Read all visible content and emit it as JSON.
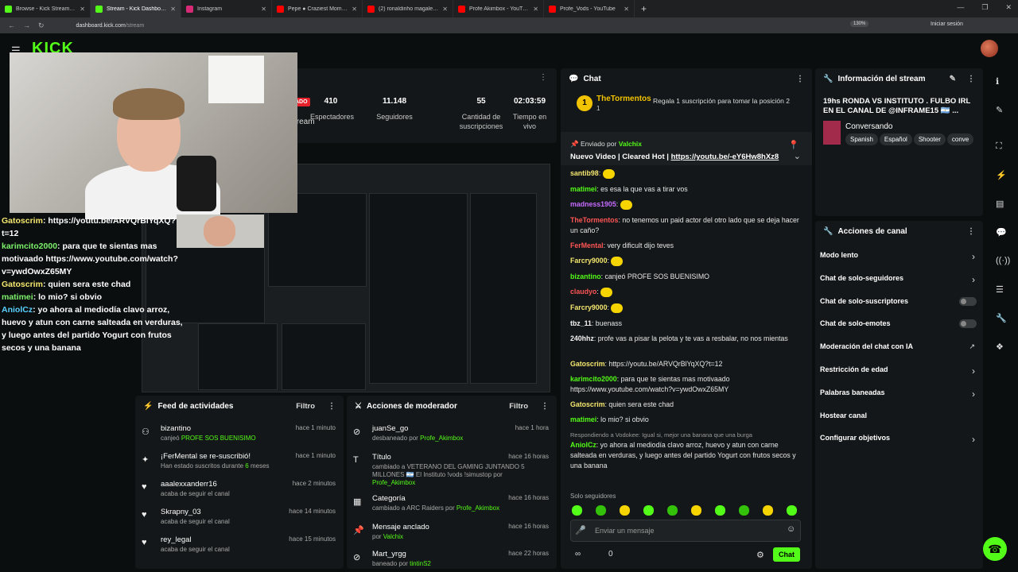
{
  "browser": {
    "tabs": [
      {
        "title": "Browse - Kick Streaming",
        "color": "#53fc18",
        "active": false
      },
      {
        "title": "Stream - Kick Dashboard",
        "color": "#53fc18",
        "active": true
      },
      {
        "title": "Instagram",
        "color": "#d62976",
        "active": false
      },
      {
        "title": "Pepe ● Craziest Moments ●",
        "color": "#ff0000",
        "active": false
      },
      {
        "title": "(2) ronaldinho magalenha - Yo",
        "color": "#ff0000",
        "active": false
      },
      {
        "title": "Profe Akimbox - YouTube",
        "color": "#ff0000",
        "active": false
      },
      {
        "title": "Profe_Vods - YouTube",
        "color": "#ff0000",
        "active": false
      }
    ],
    "url_host": "dashboard.kick.com",
    "url_path": "/stream",
    "zoom": "130%",
    "signin": "Iniciar sesión"
  },
  "header": {
    "logo": "KICK"
  },
  "stats": {
    "live_label": "ADO",
    "stream_label": "tream",
    "items": [
      {
        "value": "410",
        "label": "Espectadores"
      },
      {
        "value": "11.148",
        "label": "Seguidores"
      },
      {
        "value": "55",
        "label": "Cantidad de suscripciones"
      },
      {
        "value": "02:03:59",
        "label": "Tiempo en vivo"
      }
    ]
  },
  "overlay_chat": [
    {
      "user": "Gatoscrim",
      "text": ": https://youtu.be/ARVQrBlYqXQ?t=12"
    },
    {
      "user": "karimcito2000",
      "text": ": para que te sientas mas motivaado https://www.youtube.com/watch?v=ywdOwxZ65MY"
    },
    {
      "user": "Gatoscrim",
      "text": ": quien sera este chad"
    },
    {
      "user": "matimei",
      "text": ": lo mio? si obvio"
    },
    {
      "user": "AniolCz",
      "text": ": yo ahora al mediodía clavo arroz, huevo y atun con carne salteada en verduras, y luego antes del partido Yogurt con frutos secos y una banana"
    }
  ],
  "feed": {
    "title": "Feed de actividades",
    "filter": "Filtro",
    "items": [
      {
        "name": "bizantino",
        "desc": "canjeó",
        "extra": "PROFE SOS BUENISIMO",
        "time": "hace 1 minuto",
        "icon": "redeem-icon"
      },
      {
        "name": "¡FerMental se re-suscribió!",
        "desc": "Han estado suscritos durante",
        "extra": "6",
        "desc2": "meses",
        "time": "hace 1 minuto",
        "icon": "sparkle-icon"
      },
      {
        "name": "aaalexxanderr16",
        "desc": "acaba de seguir el canal",
        "time": "hace 2 minutos",
        "icon": "heart-icon"
      },
      {
        "name": "Skrapny_03",
        "desc": "acaba de seguir el canal",
        "time": "hace 14 minutos",
        "icon": "heart-icon"
      },
      {
        "name": "rey_legal",
        "desc": "acaba de seguir el canal",
        "time": "hace 15 minutos",
        "icon": "heart-icon"
      }
    ]
  },
  "mod": {
    "title": "Acciones de moderador",
    "filter": "Filtro",
    "items": [
      {
        "name": "juanSe_go",
        "desc": "desbaneado por",
        "by": "Profe_Akimbox",
        "time": "hace 1 hora"
      },
      {
        "name": "Título",
        "desc": "cambiado a VETERANO DEL GAMING JUNTANDO 5 MILLONES 🇦🇷 El Instituto !vods !simustop por",
        "by": "Profe_Akimbox",
        "time": "hace 16 horas"
      },
      {
        "name": "Categoría",
        "desc": "cambiado a ARC Raiders por",
        "by": "Profe_Akimbox",
        "time": "hace 16 horas"
      },
      {
        "name": "Mensaje anclado",
        "desc": "por",
        "by": "Valchix",
        "time": "hace 16 horas"
      },
      {
        "name": "Mart_yrgg",
        "desc": "baneado por",
        "by": "tintinS2",
        "time": "hace 22 horas"
      }
    ]
  },
  "chat": {
    "title": "Chat",
    "top_gifter": {
      "rank": "1",
      "name": "TheTormentos",
      "count": "1"
    },
    "gift_prompt": "Regala 1 suscripción para tomar la posición 2",
    "pinned": {
      "by_label": "Enviado por",
      "by": "Valchix",
      "text": "Nuevo Video | Cleared Hot |",
      "link": "https://youtu.be/-eY6Hw8hXz8"
    },
    "messages": [
      {
        "user": "santib98",
        "text": "",
        "color": "#f4e76e"
      },
      {
        "user": "matimei",
        "text": "es esa la que vas a tirar vos",
        "color": "#53fc18"
      },
      {
        "user": "madness1905",
        "text": "",
        "color": "#c56bff"
      },
      {
        "user": "TheTormentos",
        "text": "no tenemos un paid actor del otro lado que se deja hacer un caño?",
        "color": "#ff5555"
      },
      {
        "user": "FerMental",
        "text": "very dificult dijo teves",
        "color": "#ff5555"
      },
      {
        "user": "Farcry9000",
        "text": "",
        "color": "#f4e76e"
      },
      {
        "user": "bizantino",
        "text": "canjeó PROFE SOS BUENISIMO",
        "color": "#53fc18"
      },
      {
        "user": "claudyo",
        "text": "",
        "color": "#ff5555"
      },
      {
        "user": "Farcry9000",
        "text": "",
        "color": "#f4e76e"
      },
      {
        "user": "tbz_11",
        "text": "buenass",
        "color": "#f4f4f4"
      },
      {
        "user": "240hhz",
        "text": "profe vas a pisar la pelota y te vas a resbalar, no nos mientas",
        "color": "#f4f4f4"
      },
      {
        "user": "Gatoscrim",
        "text": "https://youtu.be/ARVQrBlYqXQ?t=12",
        "color": "#f4e76e"
      },
      {
        "user": "karimcito2000",
        "text": "para que te sientas mas motivaado https://www.youtube.com/watch?v=ywdOwxZ65MY",
        "color": "#53fc18"
      },
      {
        "user": "Gatoscrim",
        "text": "quien sera este chad",
        "color": "#f4e76e"
      },
      {
        "user": "matimei",
        "text": "lo mio? si obvio",
        "color": "#53fc18"
      },
      {
        "user": "AniolCz",
        "text": "yo ahora al mediodía clavo arroz, huevo y atun con carne salteada en verduras, y luego antes del partido Yogurt con frutos secos y una banana",
        "color": "#53fc18",
        "reply": "Respondiendo a Vodokee: Igual si, mejor una banana que una burga"
      }
    ],
    "followers_only": "Solo seguidores",
    "input_placeholder": "Enviar un mensaje",
    "points": "0",
    "send_label": "Chat"
  },
  "info": {
    "title": "Información del stream",
    "stream_title": "19hs RONDA VS INSTITUTO . FULBO IRL EN EL CANAL DE @INFRAME15 🇦🇷 ...",
    "category": "Conversando",
    "tags": [
      "Spanish",
      "Español",
      "Shooter",
      "conve"
    ]
  },
  "actions": {
    "title": "Acciones de canal",
    "items": [
      {
        "label": "Modo lento",
        "control": "chevron"
      },
      {
        "label": "Chat de solo-seguidores",
        "control": "chevron"
      },
      {
        "label": "Chat de solo-suscriptores",
        "control": "toggle"
      },
      {
        "label": "Chat de solo-emotes",
        "control": "toggle"
      },
      {
        "label": "Moderación del chat con IA",
        "control": "external"
      },
      {
        "label": "Restricción de edad",
        "control": "chevron"
      },
      {
        "label": "Palabras baneadas",
        "control": "chevron"
      },
      {
        "label": "Hostear canal",
        "control": "none"
      },
      {
        "label": "Configurar objetivos",
        "control": "chevron"
      }
    ]
  }
}
